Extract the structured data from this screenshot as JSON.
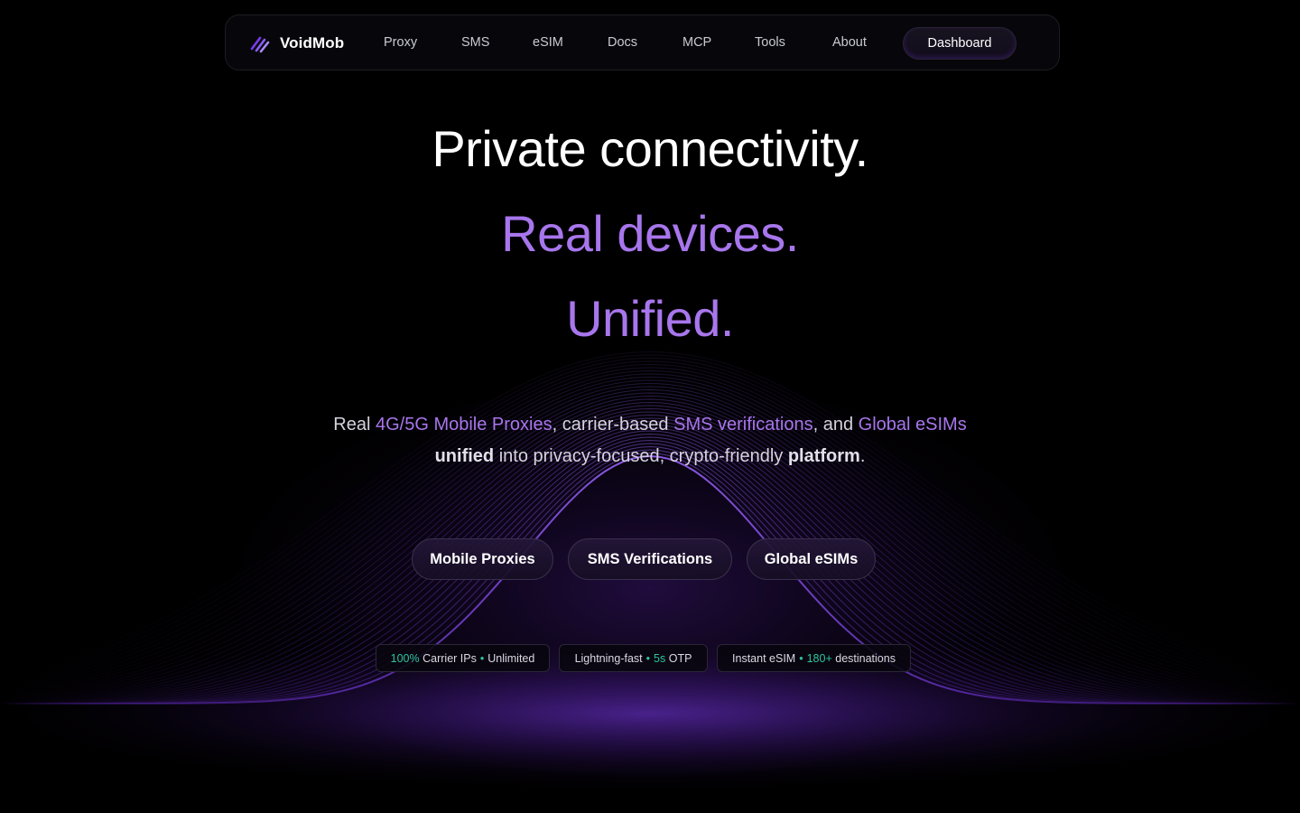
{
  "nav": {
    "brand": "VoidMob",
    "logo_icon": "slashes-logo-icon",
    "links": [
      "Proxy",
      "SMS",
      "eSIM",
      "Docs",
      "MCP",
      "Tools",
      "About"
    ],
    "dashboard_label": "Dashboard"
  },
  "hero": {
    "line1": "Private connectivity.",
    "line2": "Real devices.",
    "line3": "Unified.",
    "description": {
      "part_real": "Real",
      "mobile_proxies": "4G/5G Mobile Proxies",
      "part_carrier": ", carrier-based",
      "sms": "SMS verifications",
      "part_and": ", and",
      "esims": "Global eSIMs",
      "unified": "unified",
      "part_into": "into privacy-focused, crypto-friendly",
      "platform": "platform",
      "period": "."
    }
  },
  "cta": {
    "mobile_proxies": "Mobile Proxies",
    "sms_verifications": "SMS Verifications",
    "global_esims": "Global eSIMs"
  },
  "tags": {
    "t1_percent": "100%",
    "t1_text": "Carrier IPs",
    "t1_extra": "Unlimited",
    "t2_text": "Lightning-fast",
    "t2_value": "5s",
    "t2_extra": "OTP",
    "t3_text": "Instant eSIM",
    "t3_value": "180+",
    "t3_extra": "destinations",
    "separator": "•"
  },
  "colors": {
    "background": "#000000",
    "accent_purple": "#a876ec",
    "glow_purple": "#7c3aed",
    "accent_teal": "#2cc5a0"
  }
}
